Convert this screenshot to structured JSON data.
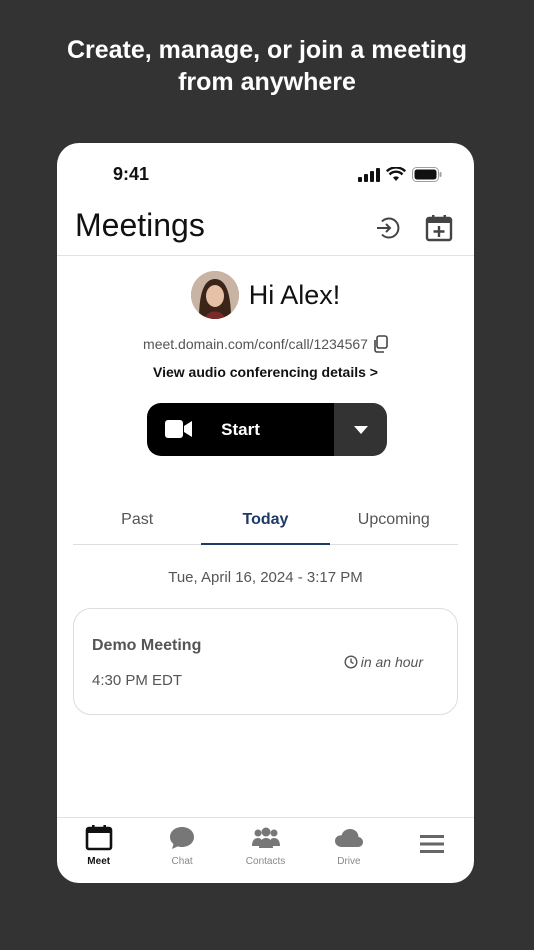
{
  "headline": {
    "line1": "Create, manage, or join a meeting",
    "line2": "from anywhere"
  },
  "status_bar": {
    "time": "9:41"
  },
  "header": {
    "title": "Meetings"
  },
  "greeting": {
    "text": "Hi Alex!"
  },
  "meeting_link": {
    "url": "meet.domain.com/conf/call/1234567"
  },
  "audio_details": {
    "label": "View audio conferencing details >"
  },
  "start_button": {
    "label": "Start"
  },
  "tabs": [
    {
      "label": "Past"
    },
    {
      "label": "Today",
      "active": true
    },
    {
      "label": "Upcoming"
    }
  ],
  "date_line": "Tue, April 16, 2024 - 3:17 PM",
  "meeting": {
    "title": "Demo Meeting",
    "time": "4:30 PM EDT",
    "relative": "in an hour"
  },
  "tab_bar": [
    {
      "label": "Meet",
      "icon": "calendar-icon",
      "active": true
    },
    {
      "label": "Chat",
      "icon": "chat-icon"
    },
    {
      "label": "Contacts",
      "icon": "contacts-icon"
    },
    {
      "label": "Drive",
      "icon": "cloud-icon"
    },
    {
      "label": "",
      "icon": "menu-icon"
    }
  ],
  "colors": {
    "background": "#333333",
    "accent": "#1e3a66",
    "button": "#000000"
  }
}
